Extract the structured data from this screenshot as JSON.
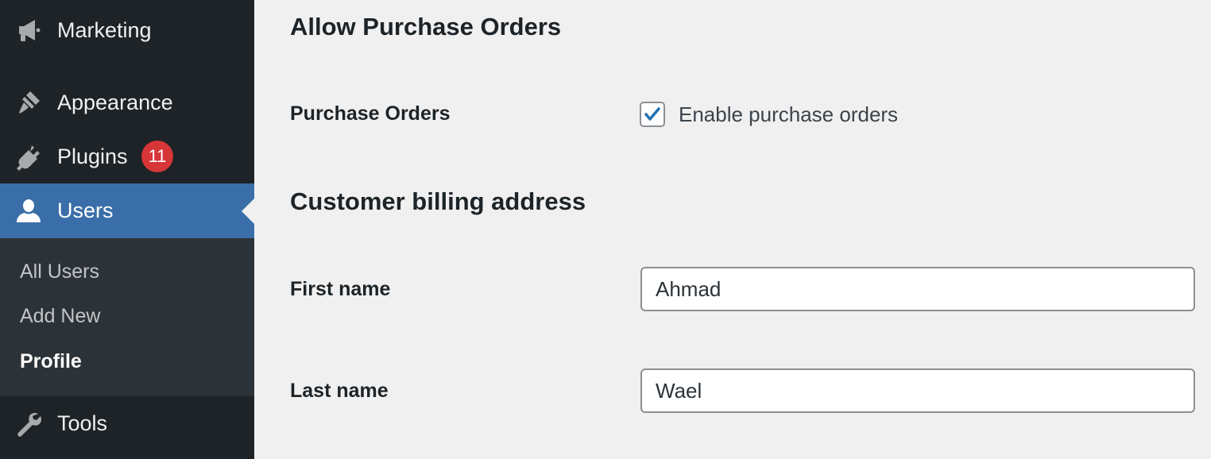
{
  "sidebar": {
    "menu": {
      "marketing": {
        "label": "Marketing",
        "icon": "megaphone-icon"
      },
      "appearance": {
        "label": "Appearance",
        "icon": "paintbrush-icon"
      },
      "plugins": {
        "label": "Plugins",
        "icon": "plug-icon",
        "badge": "11"
      },
      "users": {
        "label": "Users",
        "icon": "user-icon",
        "active": true
      },
      "tools": {
        "label": "Tools",
        "icon": "wrench-icon"
      }
    },
    "submenu": {
      "all_users": "All Users",
      "add_new": "Add New",
      "profile": "Profile",
      "current": "Profile"
    }
  },
  "main": {
    "purchase_orders_section": {
      "title": "Allow Purchase Orders",
      "field_label": "Purchase Orders",
      "checkbox_label": "Enable purchase orders",
      "checked": true
    },
    "billing_section": {
      "title": "Customer billing address",
      "first_name": {
        "label": "First name",
        "value": "Ahmad"
      },
      "last_name": {
        "label": "Last name",
        "value": "Wael"
      }
    }
  },
  "colors": {
    "sidebar_bg": "#1d2327",
    "submenu_bg": "#2c3338",
    "active_bg": "#3a6ea8",
    "badge_bg": "#d63638",
    "content_bg": "#f0f0f1",
    "checkbox_accent": "#2271b1"
  }
}
